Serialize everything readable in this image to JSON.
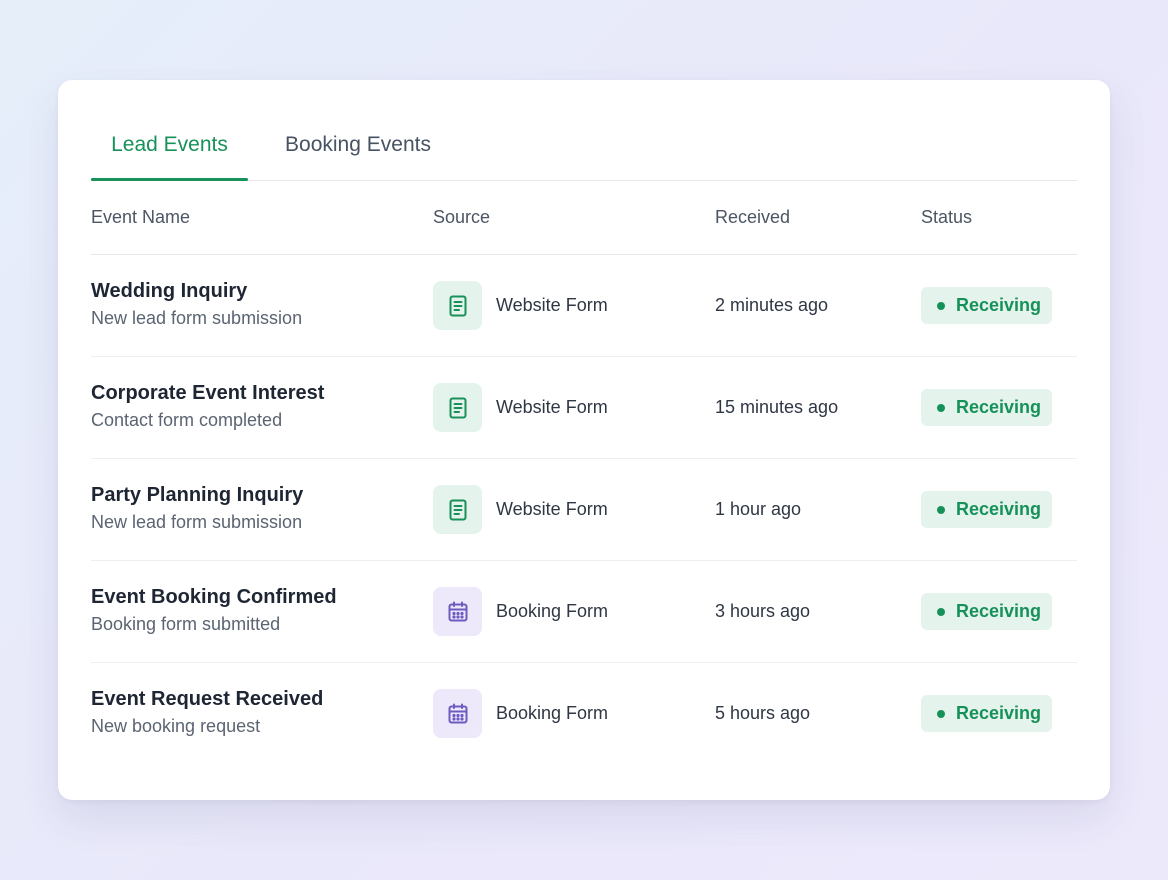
{
  "tabs": [
    {
      "label": "Lead Events",
      "active": true
    },
    {
      "label": "Booking Events",
      "active": false
    }
  ],
  "columns": {
    "name": "Event Name",
    "source": "Source",
    "received": "Received",
    "status": "Status"
  },
  "rows": [
    {
      "title": "Wedding Inquiry",
      "subtitle": "New lead form submission",
      "source": "Website Form",
      "source_icon": "document-icon",
      "received": "2 minutes ago",
      "status": "Receiving"
    },
    {
      "title": "Corporate Event Interest",
      "subtitle": "Contact form completed",
      "source": "Website Form",
      "source_icon": "document-icon",
      "received": "15 minutes ago",
      "status": "Receiving"
    },
    {
      "title": "Party Planning Inquiry",
      "subtitle": "New lead form submission",
      "source": "Website Form",
      "source_icon": "document-icon",
      "received": "1 hour ago",
      "status": "Receiving"
    },
    {
      "title": "Event Booking Confirmed",
      "subtitle": "Booking form submitted",
      "source": "Booking Form",
      "source_icon": "calendar-icon",
      "received": "3 hours ago",
      "status": "Receiving"
    },
    {
      "title": "Event Request Received",
      "subtitle": "New booking request",
      "source": "Booking Form",
      "source_icon": "calendar-icon",
      "received": "5 hours ago",
      "status": "Receiving"
    }
  ],
  "colors": {
    "accent_green": "#17915a",
    "badge_bg": "#e4f4ec",
    "booking_purple": "#6d5bc0",
    "booking_bg": "#ede9fb"
  }
}
